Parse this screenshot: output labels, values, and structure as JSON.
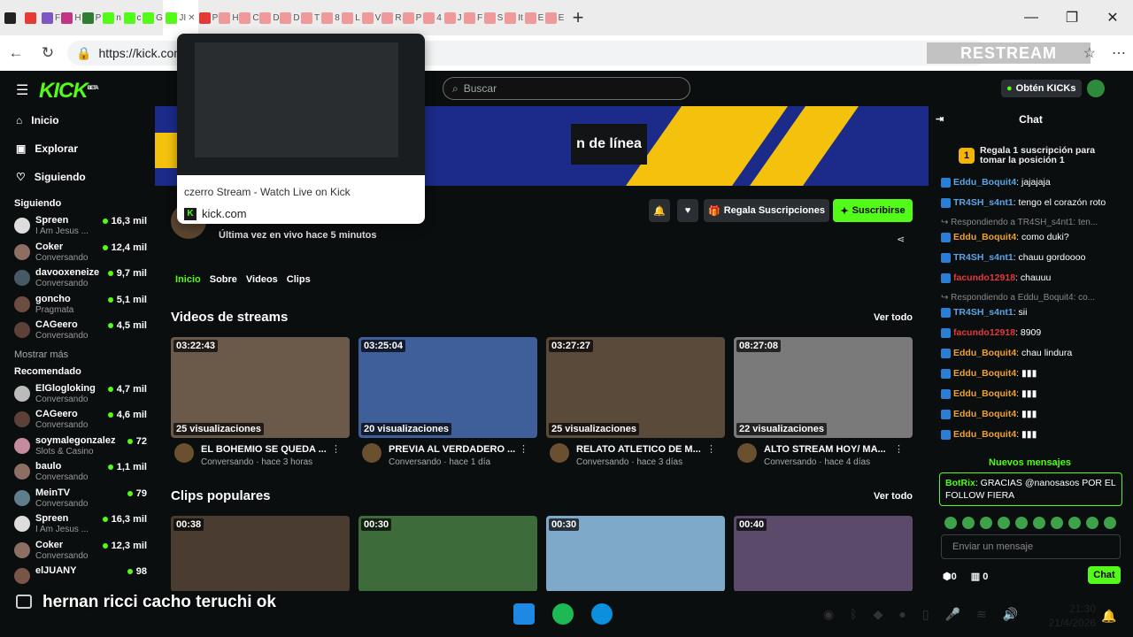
{
  "browser": {
    "tabs": [
      {
        "label": "",
        "color": "#222"
      },
      {
        "label": "",
        "color": "#e53935"
      },
      {
        "label": "F",
        "color": "#7e57c2"
      },
      {
        "label": "H",
        "color": "#c13584"
      },
      {
        "label": "P",
        "color": "#2e7d32"
      },
      {
        "label": "n",
        "color": "#53fc18"
      },
      {
        "label": "c",
        "color": "#53fc18"
      },
      {
        "label": "G",
        "color": "#53fc18"
      },
      {
        "label": "P",
        "color": "#e53935"
      },
      {
        "label": "H",
        "color": "#ef9a9a"
      },
      {
        "label": "C",
        "color": "#ef9a9a"
      },
      {
        "label": "D",
        "color": "#ef9a9a"
      },
      {
        "label": "D",
        "color": "#ef9a9a"
      },
      {
        "label": "T",
        "color": "#ef9a9a"
      },
      {
        "label": "8",
        "color": "#ef9a9a"
      },
      {
        "label": "L",
        "color": "#ef9a9a"
      },
      {
        "label": "V",
        "color": "#ef9a9a"
      },
      {
        "label": "R",
        "color": "#ef9a9a"
      },
      {
        "label": "P",
        "color": "#ef9a9a"
      },
      {
        "label": "4",
        "color": "#ef9a9a"
      },
      {
        "label": "J",
        "color": "#ef9a9a"
      },
      {
        "label": "F",
        "color": "#ef9a9a"
      },
      {
        "label": "S",
        "color": "#ef9a9a"
      },
      {
        "label": "It",
        "color": "#ef9a9a"
      },
      {
        "label": "E",
        "color": "#ef9a9a"
      },
      {
        "label": "E",
        "color": "#ef9a9a"
      }
    ],
    "active_tab_label": "JI",
    "url": "https://kick.com",
    "restream_label": "RESTREAM"
  },
  "tooltip": {
    "title": "czerro Stream - Watch Live on Kick",
    "site": "kick.com"
  },
  "kick": {
    "logo": "KICK",
    "logo_badge": "BETA",
    "search_placeholder": "Buscar",
    "get_kicks": "Obtén KICKs",
    "nav": [
      {
        "label": "Inicio",
        "icon": "home-icon",
        "glyph": "⌂"
      },
      {
        "label": "Explorar",
        "icon": "browse-icon",
        "glyph": "▣"
      },
      {
        "label": "Siguiendo",
        "icon": "heart-icon",
        "glyph": "♡"
      }
    ],
    "following_title": "Siguiendo",
    "following": [
      {
        "name": "Spreen",
        "category": "I Am Jesus ...",
        "viewers": "16,3 mil",
        "color": "#ddd"
      },
      {
        "name": "Coker",
        "category": "Conversando",
        "viewers": "12,4 mil",
        "color": "#8d6e63"
      },
      {
        "name": "davooxeneize",
        "category": "Conversando",
        "viewers": "9,7 mil",
        "color": "#455a64"
      },
      {
        "name": "goncho",
        "category": "Pragmata",
        "viewers": "5,1 mil",
        "color": "#6d4c41"
      },
      {
        "name": "CAGeero",
        "category": "Conversando",
        "viewers": "4,5 mil",
        "color": "#5d4037"
      }
    ],
    "show_more": "Mostrar más",
    "recommended_title": "Recomendado",
    "recommended": [
      {
        "name": "ElGlogloking",
        "category": "Conversando",
        "viewers": "4,7 mil",
        "color": "#bbb"
      },
      {
        "name": "CAGeero",
        "category": "Conversando",
        "viewers": "4,6 mil",
        "color": "#5d4037"
      },
      {
        "name": "soymalegonzalez",
        "category": "Slots & Casino",
        "viewers": "72",
        "color": "#c48b9f"
      },
      {
        "name": "baulo",
        "category": "Conversando",
        "viewers": "1,1 mil",
        "color": "#8d6e63"
      },
      {
        "name": "MeinTV",
        "category": "Conversando",
        "viewers": "79",
        "color": "#607d8b"
      },
      {
        "name": "Spreen",
        "category": "I Am Jesus ...",
        "viewers": "16,3 mil",
        "color": "#ddd"
      },
      {
        "name": "Coker",
        "category": "Conversando",
        "viewers": "12,3 mil",
        "color": "#8d6e63"
      },
      {
        "name": "elJUANY",
        "category": "",
        "viewers": "98",
        "color": "#795548"
      }
    ],
    "banner_text": "n de línea",
    "channel": {
      "last_live": "Última vez en vivo hace 5 minutos",
      "gift_button": "Regala Suscripciones",
      "subscribe_button": "Suscribirse"
    },
    "tabs": [
      "Inicio",
      "Sobre",
      "Videos",
      "Clips"
    ],
    "videos_title": "Videos de streams",
    "see_all": "Ver todo",
    "videos": [
      {
        "duration": "03:22:43",
        "views": "25 visualizaciones",
        "title": "EL BOHEMIO SE QUEDA ...",
        "sub": "Conversando · hace 3 horas",
        "bg": "#6b5a4a"
      },
      {
        "duration": "03:25:04",
        "views": "20 visualizaciones",
        "title": "PREVIA AL VERDADERO ...",
        "sub": "Conversando · hace 1 día",
        "bg": "#3f5f9a"
      },
      {
        "duration": "03:27:27",
        "views": "25 visualizaciones",
        "title": "RELATO ATLETICO DE M...",
        "sub": "Conversando · hace 3 días",
        "bg": "#5a4a3a"
      },
      {
        "duration": "08:27:08",
        "views": "22 visualizaciones",
        "title": "ALTO STREAM HOY/ MA...",
        "sub": "Conversando · hace 4 días",
        "bg": "#7a7a7a"
      }
    ],
    "clips_title": "Clips populares",
    "clips": [
      {
        "duration": "00:38",
        "bg": "#4a3c30"
      },
      {
        "duration": "00:30",
        "bg": "#3e6b3a"
      },
      {
        "duration": "00:30",
        "bg": "#7fa9c9"
      },
      {
        "duration": "00:40",
        "bg": "#5b4a6a"
      }
    ],
    "chat": {
      "title": "Chat",
      "gift_rank": "1",
      "gift_text": "Regala 1 suscripción para tomar la posición 1",
      "messages": [
        {
          "type": "msg",
          "user": "Eddu_Boquit4",
          "color": "#5ba4e5",
          "text": ": jajajaja"
        },
        {
          "type": "msg",
          "user": "TR4SH_s4nt1",
          "color": "#5ba4e5",
          "text": ": tengo el corazón roto"
        },
        {
          "type": "reply",
          "text": "↪ Respondiendo a TR4SH_s4nt1: ten..."
        },
        {
          "type": "msg",
          "user": "Eddu_Boquit4",
          "color": "#f0a030",
          "text": ": como duki?"
        },
        {
          "type": "msg",
          "user": "TR4SH_s4nt1",
          "color": "#5ba4e5",
          "text": ": chauu gordoooo"
        },
        {
          "type": "msg",
          "user": "facundo12918",
          "color": "#e5383b",
          "text": ": chauuu"
        },
        {
          "type": "reply",
          "text": "↪ Respondiendo a Eddu_Boquit4: co..."
        },
        {
          "type": "msg",
          "user": "TR4SH_s4nt1",
          "color": "#5ba4e5",
          "text": ": sii"
        },
        {
          "type": "msg",
          "user": "facundo12918",
          "color": "#e5383b",
          "text": ": 8909"
        },
        {
          "type": "msg",
          "user": "Eddu_Boquit4",
          "color": "#f0a030",
          "text": ": chau lindura"
        },
        {
          "type": "msg",
          "user": "Eddu_Boquit4",
          "color": "#f0a030",
          "text": ": ▮▮▮"
        },
        {
          "type": "msg",
          "user": "Eddu_Boquit4",
          "color": "#f0a030",
          "text": ": ▮▮▮"
        },
        {
          "type": "msg",
          "user": "Eddu_Boquit4",
          "color": "#f0a030",
          "text": ": ▮▮▮"
        },
        {
          "type": "msg",
          "user": "Eddu_Boquit4",
          "color": "#f0a030",
          "text": ": ▮▮▮"
        }
      ],
      "new_messages": "Nuevos mensajes",
      "pinned_user": "BotRix",
      "pinned_text": ": GRACIAS @nanosasos POR EL FOLLOW FIERA",
      "input_placeholder": "Enviar un mensaje",
      "count_a": "0",
      "count_b": "0",
      "send_button": "Chat"
    }
  },
  "subtitle": "hernan ricci cacho teruchi ok",
  "taskbar": {
    "time": "21:30",
    "date": "21/4/2026"
  }
}
